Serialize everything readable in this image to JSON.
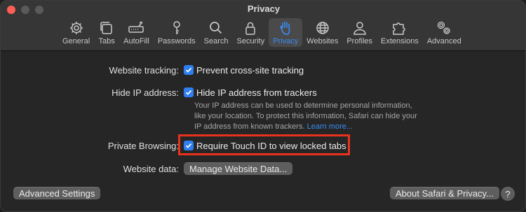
{
  "window": {
    "title": "Privacy"
  },
  "tabs": [
    {
      "label": "General",
      "icon": "gear-icon"
    },
    {
      "label": "Tabs",
      "icon": "tabs-icon"
    },
    {
      "label": "AutoFill",
      "icon": "autofill-icon"
    },
    {
      "label": "Passwords",
      "icon": "key-icon"
    },
    {
      "label": "Search",
      "icon": "search-icon"
    },
    {
      "label": "Security",
      "icon": "lock-icon"
    },
    {
      "label": "Privacy",
      "icon": "hand-icon",
      "active": true
    },
    {
      "label": "Websites",
      "icon": "globe-icon"
    },
    {
      "label": "Profiles",
      "icon": "person-icon"
    },
    {
      "label": "Extensions",
      "icon": "puzzle-icon"
    },
    {
      "label": "Advanced",
      "icon": "gears-icon"
    }
  ],
  "settings": {
    "website_tracking": {
      "label": "Website tracking:",
      "checkbox": "Prevent cross-site tracking",
      "checked": true
    },
    "hide_ip": {
      "label": "Hide IP address:",
      "checkbox": "Hide IP address from trackers",
      "checked": true,
      "description": "Your IP address can be used to determine personal information, like your location. To protect this information, Safari can hide your IP address from known trackers.",
      "link": "Learn more..."
    },
    "private_browsing": {
      "label": "Private Browsing:",
      "checkbox": "Require Touch ID to view locked tabs",
      "checked": true
    },
    "website_data": {
      "label": "Website data:",
      "button": "Manage Website Data..."
    }
  },
  "footer": {
    "advanced_settings": "Advanced Settings",
    "about": "About Safari & Privacy...",
    "help": "?"
  },
  "colors": {
    "accent": "#2f7ff0",
    "highlight_box": "#e8321e",
    "link": "#3b8cf5"
  }
}
